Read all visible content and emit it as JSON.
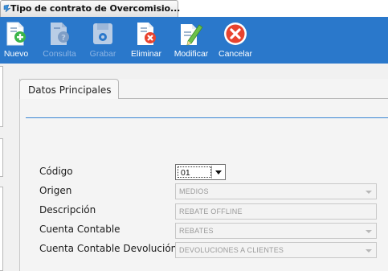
{
  "window": {
    "tab_title": "Tipo de contrato de Overcomisio..."
  },
  "toolbar": {
    "buttons": [
      {
        "id": "nuevo",
        "label": "Nuevo",
        "icon": "new-document-icon",
        "enabled": true
      },
      {
        "id": "consulta",
        "label": "Consulta",
        "icon": "query-document-icon",
        "enabled": false
      },
      {
        "id": "grabar",
        "label": "Grabar",
        "icon": "save-disk-icon",
        "enabled": false
      },
      {
        "id": "eliminar",
        "label": "Eliminar",
        "icon": "delete-document-icon",
        "enabled": true
      },
      {
        "id": "modificar",
        "label": "Modificar",
        "icon": "edit-document-icon",
        "enabled": true
      },
      {
        "id": "cancelar",
        "label": "Cancelar",
        "icon": "cancel-icon",
        "enabled": true
      }
    ]
  },
  "panel": {
    "tab_label": "Datos Principales"
  },
  "form": {
    "codigo": {
      "label": "Código",
      "value": "01"
    },
    "origen": {
      "label": "Origen",
      "value": "MEDIOS"
    },
    "descripcion": {
      "label": "Descripción",
      "value": "REBATE OFFLINE"
    },
    "cuenta_contable": {
      "label": "Cuenta Contable",
      "value": "REBATES"
    },
    "cuenta_contable_devolucion": {
      "label": "Cuenta Contable Devolución",
      "value": "DEVOLUCIONES A CLIENTES"
    }
  },
  "colors": {
    "toolbar_bg": "#2a78cb",
    "accent_rule": "#3a86d4",
    "cancel_red": "#e8432f",
    "add_green": "#3bb54a"
  }
}
